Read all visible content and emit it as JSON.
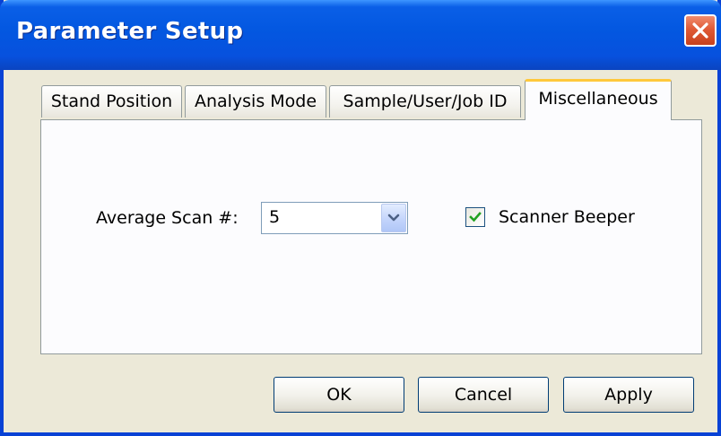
{
  "window": {
    "title": "Parameter Setup",
    "close_icon": "close-icon"
  },
  "tabs": [
    {
      "label": "Stand Position",
      "active": false
    },
    {
      "label": "Analysis Mode",
      "active": false
    },
    {
      "label": "Sample/User/Job ID",
      "active": false
    },
    {
      "label": "Miscellaneous",
      "active": true
    }
  ],
  "misc": {
    "average_scan_label": "Average Scan #:",
    "average_scan_value": "5",
    "scanner_beeper_label": "Scanner Beeper",
    "scanner_beeper_checked": true
  },
  "buttons": {
    "ok": "OK",
    "cancel": "Cancel",
    "apply": "Apply"
  },
  "colors": {
    "title_bar": "#0357e0",
    "active_tab_accent": "#ffc83c",
    "checkmark": "#21a121",
    "close_button": "#e05a36"
  }
}
